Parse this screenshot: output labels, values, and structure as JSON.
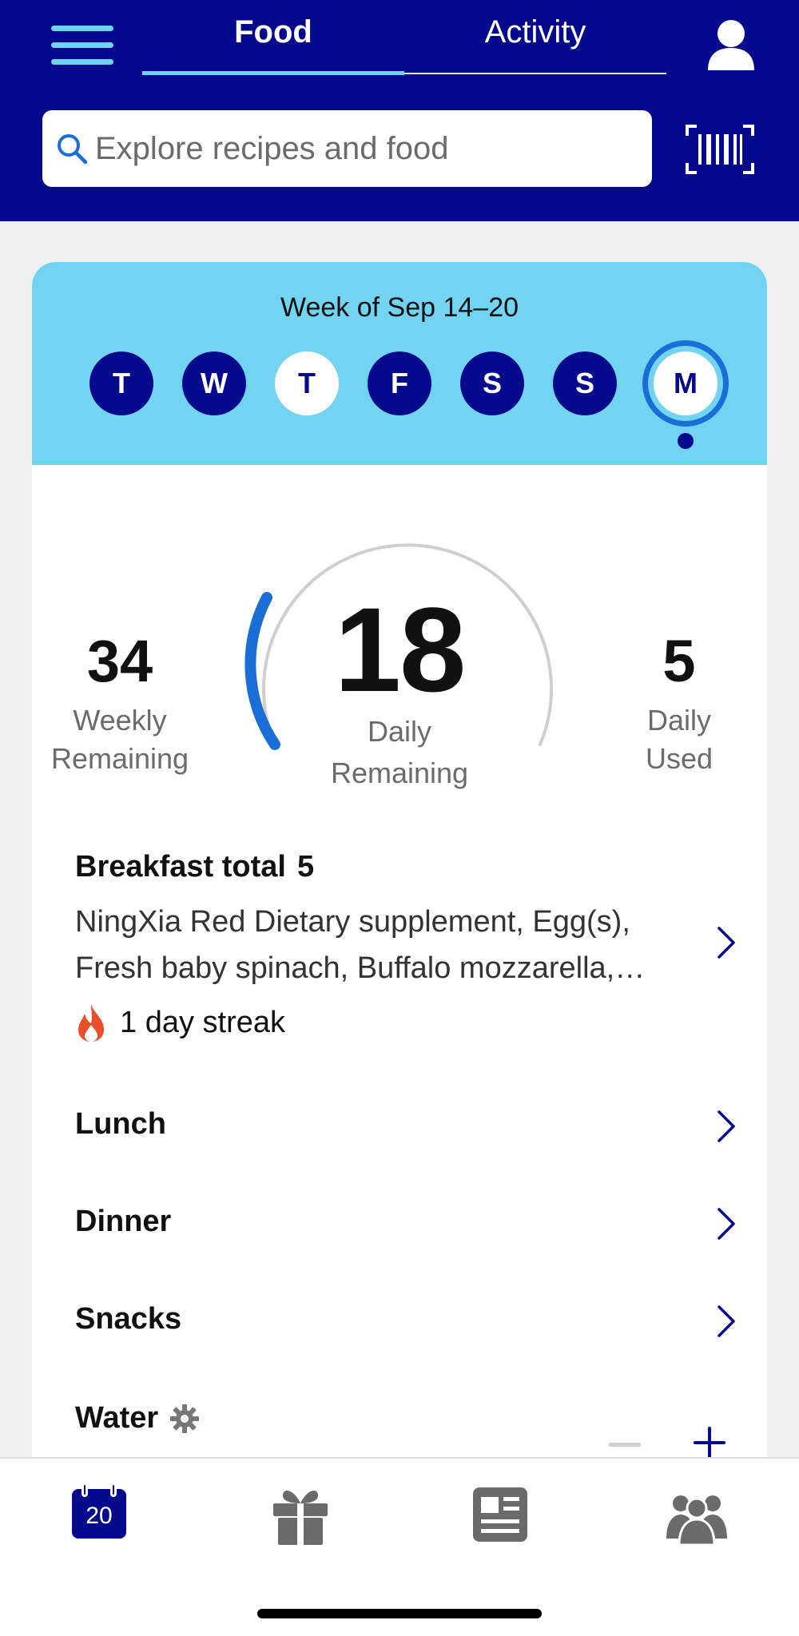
{
  "header": {
    "tabs": [
      {
        "label": "Food",
        "active": true
      },
      {
        "label": "Activity",
        "active": false
      }
    ],
    "accent_color": "#050a8c",
    "highlight_color": "#6fd3f2"
  },
  "search": {
    "placeholder": "Explore recipes and food"
  },
  "week": {
    "title": "Week of Sep 14–20",
    "days": [
      {
        "label": "T",
        "state": "filled"
      },
      {
        "label": "W",
        "state": "filled"
      },
      {
        "label": "T",
        "state": "light"
      },
      {
        "label": "F",
        "state": "filled"
      },
      {
        "label": "S",
        "state": "filled"
      },
      {
        "label": "S",
        "state": "filled"
      },
      {
        "label": "M",
        "state": "selected"
      }
    ]
  },
  "points": {
    "weekly_remaining": {
      "value": "34",
      "label_1": "Weekly",
      "label_2": "Remaining"
    },
    "daily_remaining": {
      "value": "18",
      "label_1": "Daily",
      "label_2": "Remaining"
    },
    "daily_used": {
      "value": "5",
      "label_1": "Daily",
      "label_2": "Used"
    }
  },
  "meals": {
    "breakfast": {
      "title": "Breakfast total",
      "total": "5",
      "items": "NingXia Red Dietary supplement, Egg(s), Fresh baby spinach, Buffalo mozzarella, Avocado",
      "streak": "1 day streak"
    },
    "lunch": {
      "title": "Lunch"
    },
    "dinner": {
      "title": "Dinner"
    },
    "snacks": {
      "title": "Snacks"
    },
    "water": {
      "title": "Water"
    }
  },
  "bottom_nav": {
    "calendar_day": "20",
    "items": [
      "calendar-icon",
      "gift-icon",
      "news-icon",
      "community-icon"
    ]
  }
}
